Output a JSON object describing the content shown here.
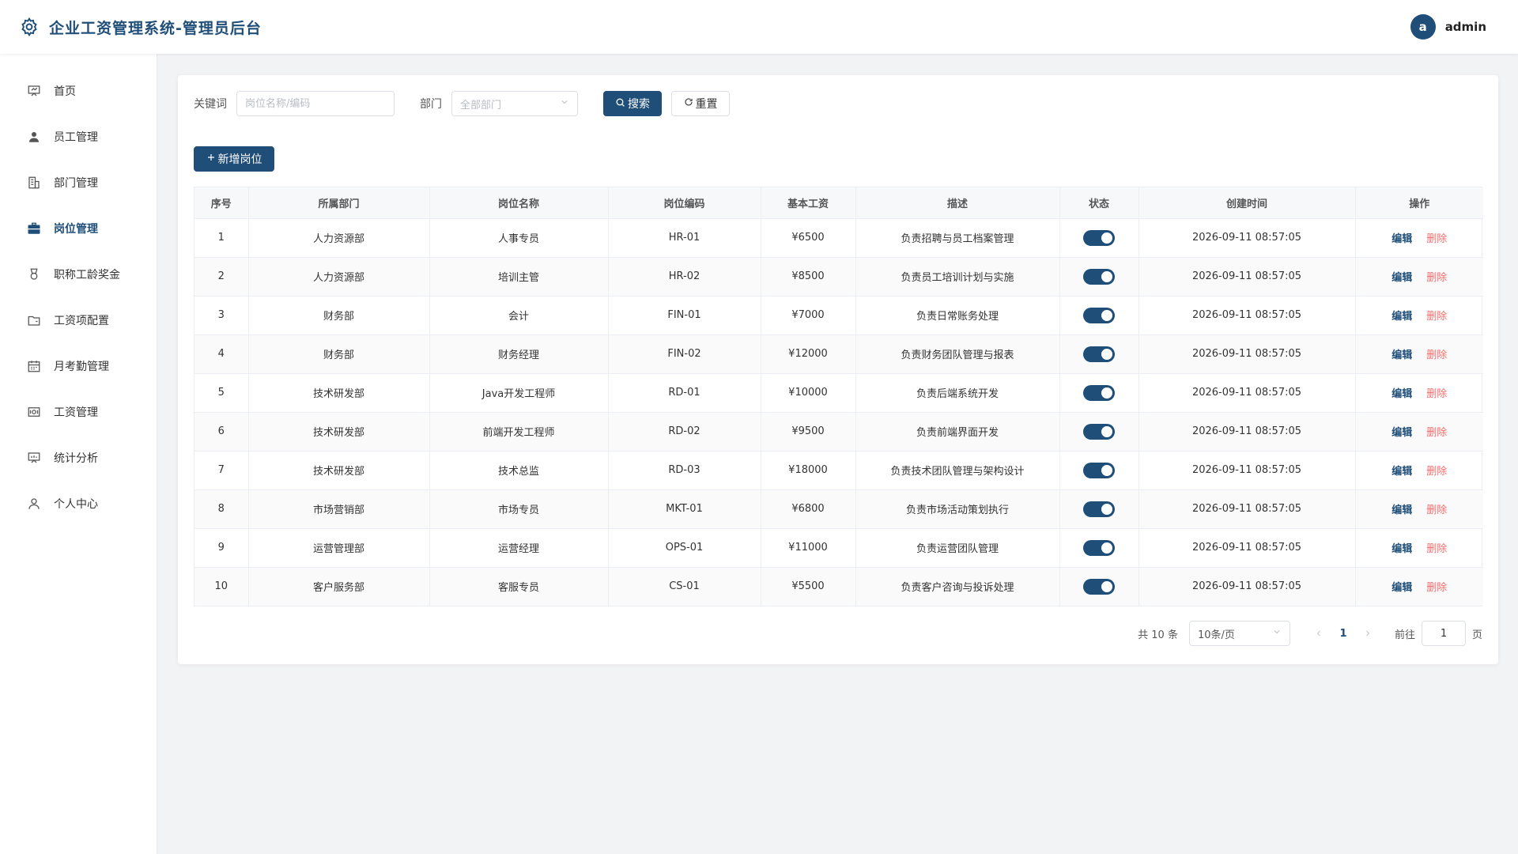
{
  "header": {
    "title": "企业工资管理系统-管理员后台",
    "avatar_letter": "a",
    "username": "admin"
  },
  "sidebar": {
    "items": [
      {
        "label": "首页",
        "icon": "presentation-icon",
        "active": false
      },
      {
        "label": "员工管理",
        "icon": "user-icon",
        "active": false
      },
      {
        "label": "部门管理",
        "icon": "building-icon",
        "active": false
      },
      {
        "label": "岗位管理",
        "icon": "briefcase-icon",
        "active": true
      },
      {
        "label": "职称工龄奖金",
        "icon": "medal-icon",
        "active": false
      },
      {
        "label": "工资项配置",
        "icon": "wallet-icon",
        "active": false
      },
      {
        "label": "月考勤管理",
        "icon": "calendar-icon",
        "active": false
      },
      {
        "label": "工资管理",
        "icon": "money-icon",
        "active": false
      },
      {
        "label": "统计分析",
        "icon": "chart-board-icon",
        "active": false
      },
      {
        "label": "个人中心",
        "icon": "person-icon",
        "active": false
      }
    ]
  },
  "filters": {
    "keyword_label": "关键词",
    "keyword_placeholder": "岗位名称/编码",
    "keyword_value": "",
    "dept_label": "部门",
    "dept_value": "全部部门",
    "search_label": "搜索",
    "reset_label": "重置"
  },
  "actions": {
    "add_label": "新增岗位"
  },
  "table": {
    "headers": [
      "序号",
      "所属部门",
      "岗位名称",
      "岗位编码",
      "基本工资",
      "描述",
      "状态",
      "创建时间",
      "操作"
    ],
    "edit_label": "编辑",
    "delete_label": "删除",
    "rows": [
      {
        "no": "1",
        "dept": "人力资源部",
        "name": "人事专员",
        "code": "HR-01",
        "salary": "¥6500",
        "desc": "负责招聘与员工档案管理",
        "enabled": true,
        "created": "2026-09-11 08:57:05"
      },
      {
        "no": "2",
        "dept": "人力资源部",
        "name": "培训主管",
        "code": "HR-02",
        "salary": "¥8500",
        "desc": "负责员工培训计划与实施",
        "enabled": true,
        "created": "2026-09-11 08:57:05"
      },
      {
        "no": "3",
        "dept": "财务部",
        "name": "会计",
        "code": "FIN-01",
        "salary": "¥7000",
        "desc": "负责日常账务处理",
        "enabled": true,
        "created": "2026-09-11 08:57:05"
      },
      {
        "no": "4",
        "dept": "财务部",
        "name": "财务经理",
        "code": "FIN-02",
        "salary": "¥12000",
        "desc": "负责财务团队管理与报表",
        "enabled": true,
        "created": "2026-09-11 08:57:05"
      },
      {
        "no": "5",
        "dept": "技术研发部",
        "name": "Java开发工程师",
        "code": "RD-01",
        "salary": "¥10000",
        "desc": "负责后端系统开发",
        "enabled": true,
        "created": "2026-09-11 08:57:05"
      },
      {
        "no": "6",
        "dept": "技术研发部",
        "name": "前端开发工程师",
        "code": "RD-02",
        "salary": "¥9500",
        "desc": "负责前端界面开发",
        "enabled": true,
        "created": "2026-09-11 08:57:05"
      },
      {
        "no": "7",
        "dept": "技术研发部",
        "name": "技术总监",
        "code": "RD-03",
        "salary": "¥18000",
        "desc": "负责技术团队管理与架构设计",
        "enabled": true,
        "created": "2026-09-11 08:57:05"
      },
      {
        "no": "8",
        "dept": "市场营销部",
        "name": "市场专员",
        "code": "MKT-01",
        "salary": "¥6800",
        "desc": "负责市场活动策划执行",
        "enabled": true,
        "created": "2026-09-11 08:57:05"
      },
      {
        "no": "9",
        "dept": "运营管理部",
        "name": "运营经理",
        "code": "OPS-01",
        "salary": "¥11000",
        "desc": "负责运营团队管理",
        "enabled": true,
        "created": "2026-09-11 08:57:05"
      },
      {
        "no": "10",
        "dept": "客户服务部",
        "name": "客服专员",
        "code": "CS-01",
        "salary": "¥5500",
        "desc": "负责客户咨询与投诉处理",
        "enabled": true,
        "created": "2026-09-11 08:57:05"
      }
    ]
  },
  "pagination": {
    "total_text": "共 10 条",
    "page_size": "10条/页",
    "current_page": "1",
    "goto_label": "前往",
    "goto_value": "1",
    "page_suffix": "页"
  },
  "colors": {
    "primary": "#1f4e79",
    "danger": "#f56c6c",
    "background": "#f2f3f5"
  }
}
